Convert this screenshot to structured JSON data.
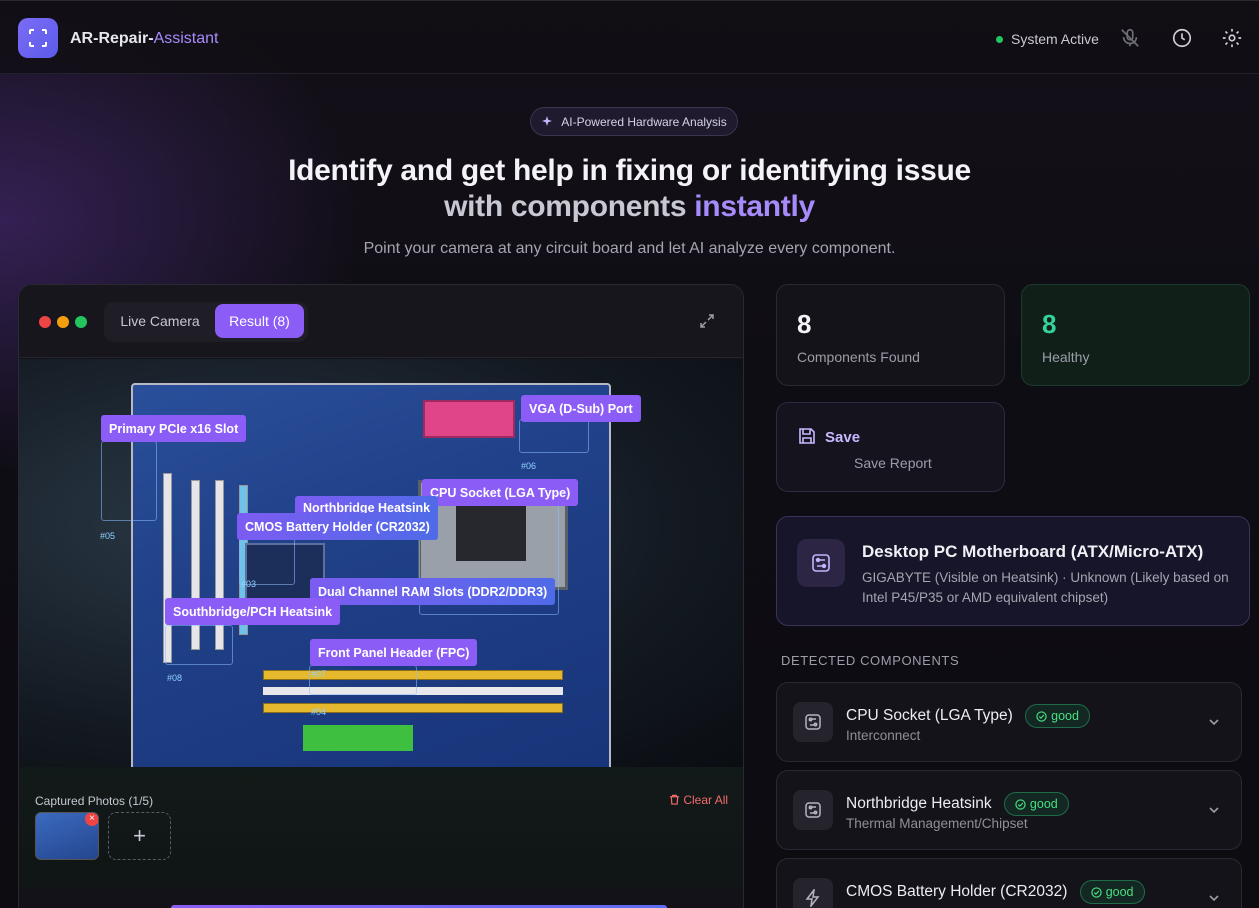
{
  "app": {
    "name_main": "AR-Repair-",
    "name_accent": "Assistant"
  },
  "header": {
    "status": "System Active"
  },
  "hero": {
    "pill": "AI-Powered Hardware Analysis",
    "line1": "Identify and get help in fixing or identifying issue",
    "line2_plain": "with components ",
    "line2_accent": "instantly",
    "subtitle": "Point your camera at any circuit board and let AI analyze every component."
  },
  "camera": {
    "tab_live": "Live Camera",
    "tab_result": "Result (8)",
    "labels": [
      "Primary PCIe x16 Slot",
      "VGA (D-Sub) Port",
      "CPU Socket (LGA Type)",
      "Northbridge Heatsink",
      "CMOS Battery Holder (CR2032)",
      "Dual Channel RAM Slots (DDR2/DDR3)",
      "Southbridge/PCH Heatsink",
      "Front Panel Header (FPC)"
    ],
    "markers": [
      "#05",
      "#06",
      "#03",
      "#08",
      "#07",
      "#04"
    ],
    "photos_title": "Captured Photos (1/5)",
    "clear_all": "Clear All",
    "add_symbol": "+"
  },
  "stats": {
    "components_value": "8",
    "components_label": "Components Found",
    "healthy_value": "8",
    "healthy_label": "Healthy"
  },
  "save": {
    "title": "Save",
    "subtitle": "Save Report"
  },
  "device": {
    "title": "Desktop PC Motherboard (ATX/Micro-ATX)",
    "subtitle": "GIGABYTE (Visible on Heatsink) · Unknown (Likely based on Intel P45/P35 or AMD equivalent chipset)"
  },
  "detected_title": "DETECTED COMPONENTS",
  "components": [
    {
      "name": "CPU Socket (LGA Type)",
      "category": "Interconnect",
      "status": "good",
      "icon": "chip-icon"
    },
    {
      "name": "Northbridge Heatsink",
      "category": "Thermal Management/Chipset",
      "status": "good",
      "icon": "chip-icon"
    },
    {
      "name": "CMOS Battery Holder (CR2032)",
      "category": "Power/Storage",
      "status": "good",
      "icon": "bolt-icon"
    }
  ],
  "colors": {
    "accent": "#8b5cf6",
    "healthy": "#34d399",
    "danger": "#ef4444"
  }
}
